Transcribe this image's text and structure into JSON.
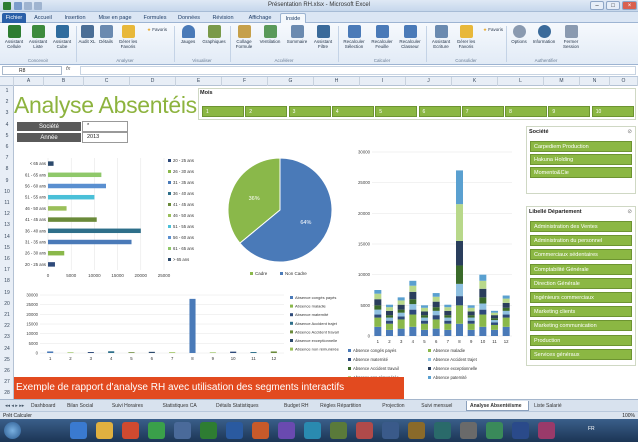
{
  "window": {
    "title": "Présentation RH.xlsx - Microsoft Excel"
  },
  "ribbon": {
    "tabs": [
      "Fichier",
      "Accueil",
      "Insertion",
      "Mise en page",
      "Formules",
      "Données",
      "Révision",
      "Affichage",
      "Inside"
    ],
    "active_tab": "Inside",
    "favoris_label": "Favoris",
    "buttons": [
      "Assistant Cellule",
      "Assistant Liste",
      "Assistant Cube",
      "Audit XL",
      "Détails",
      "Gérer les Favoris",
      "Jauges",
      "Graphiques",
      "Collage Formule",
      "Ventilation",
      "Sommaire",
      "Assistant Filtre",
      "Recalculer Sélection",
      "Recalculer Feuille",
      "Recalculer Classeur",
      "Assistant Ecriture",
      "Gérer les Favoris",
      "Options",
      "Information",
      "Fermer Session"
    ],
    "groups": [
      "Concevoir",
      "Analyser",
      "Visualiser",
      "Accélérer",
      "Calculer",
      "Consolider",
      "Authentifier"
    ]
  },
  "formula_bar": {
    "name_box": "R8",
    "fx": "fx"
  },
  "columns": [
    "A",
    "B",
    "C",
    "D",
    "E",
    "F",
    "G",
    "H",
    "I",
    "J",
    "K",
    "L",
    "M",
    "N",
    "O"
  ],
  "rows": [
    "1",
    "2",
    "3",
    "4",
    "5",
    "6",
    "7",
    "8",
    "9",
    "10",
    "11",
    "12",
    "13",
    "14",
    "15",
    "16",
    "17",
    "18",
    "19",
    "20",
    "21",
    "22",
    "23",
    "24",
    "25",
    "26",
    "27",
    "28"
  ],
  "dashboard": {
    "title": "Analyse Absentéisme",
    "filters": [
      {
        "label": "Société",
        "value": "*"
      },
      {
        "label": "Année",
        "value": "2013"
      }
    ],
    "mois_label": "Mois",
    "mois": [
      "1",
      "2",
      "3",
      "4",
      "5",
      "6",
      "7",
      "8",
      "9",
      "10"
    ],
    "societe_slicer": {
      "title": "Société",
      "items": [
        "Carpediem Production",
        "Hakuna Holding",
        "Momento&Cie"
      ]
    },
    "departement_slicer": {
      "title": "Libellé Département",
      "items": [
        "Administration des Ventes",
        "Administration du personnel",
        "Commerciaux sédentaires",
        "Comptabilité Générale",
        "Direction Générale",
        "Ingénieurs commerciaux",
        "Marketing clients",
        "Marketing communication",
        "Production",
        "Services généraux"
      ]
    },
    "banner": "Exemple de rapport d'analyse RH avec utilisation des segments interactifs"
  },
  "chart_data": [
    {
      "type": "bar",
      "orientation": "horizontal",
      "categories": [
        "< 65 ans",
        "61 - 65 ans",
        "56 - 60 ans",
        "51 - 55 ans",
        "46 - 50 ans",
        "41 - 45 ans",
        "36 - 40 ans",
        "31 - 35 ans",
        "26 - 30 ans",
        "20 - 25 ans"
      ],
      "values": [
        1200,
        11500,
        12500,
        10000,
        4000,
        10500,
        20000,
        18000,
        3500,
        1500
      ],
      "xlim": [
        0,
        25000
      ],
      "xticks": [
        "0",
        "5000",
        "10000",
        "15000",
        "20000",
        "25000"
      ],
      "legend": [
        "20 - 25 ans",
        "26 - 30 ans",
        "31 - 35 ans",
        "36 - 40 ans",
        "41 - 45 ans",
        "46 - 50 ans",
        "51 - 55 ans",
        "56 - 60 ans",
        "61 - 65 ans",
        "> 65 ans"
      ],
      "colors": [
        "#2e4a7a",
        "#8ab84a",
        "#4a7ab8",
        "#2e6f8a",
        "#6a8a3a",
        "#9abf5a",
        "#4ac0d8",
        "#5a8fd0",
        "#8fc86a",
        "#2c4a6c"
      ]
    },
    {
      "type": "pie",
      "categories": [
        "Cadre",
        "Non Cadre"
      ],
      "values": [
        36,
        64
      ],
      "labels": [
        "36%",
        "64%"
      ],
      "colors": [
        "#8ab84a",
        "#4a7ab8"
      ]
    },
    {
      "type": "bar",
      "stacked": true,
      "categories": [
        "1",
        "2",
        "3",
        "4",
        "5",
        "6",
        "7",
        "8",
        "9",
        "10",
        "11",
        "12"
      ],
      "ylim": [
        0,
        30000
      ],
      "yticks": [
        "0",
        "5000",
        "10000",
        "15000",
        "20000",
        "25000",
        "30000"
      ],
      "series": [
        {
          "name": "Absence congés payés",
          "values": [
            1500,
            1000,
            1200,
            1500,
            1000,
            1200,
            1000,
            2000,
            1000,
            1500,
            1000,
            1500
          ]
        },
        {
          "name": "Absence maladie",
          "values": [
            1500,
            1000,
            1500,
            2000,
            1000,
            1500,
            1000,
            3000,
            1000,
            2000,
            800,
            1500
          ]
        },
        {
          "name": "Absence maternité",
          "values": [
            500,
            500,
            500,
            800,
            500,
            700,
            500,
            1500,
            500,
            800,
            400,
            500
          ]
        },
        {
          "name": "Absence Accident trajet",
          "values": [
            800,
            500,
            600,
            900,
            500,
            700,
            500,
            2000,
            500,
            1000,
            400,
            600
          ]
        },
        {
          "name": "Absence Accident travail",
          "values": [
            700,
            400,
            500,
            800,
            400,
            600,
            400,
            3000,
            400,
            1000,
            300,
            500
          ]
        },
        {
          "name": "Absence exceptionnelle",
          "values": [
            1000,
            700,
            800,
            1200,
            600,
            900,
            700,
            4000,
            600,
            1400,
            500,
            800
          ]
        },
        {
          "name": "Absence non rémunérée",
          "values": [
            900,
            600,
            700,
            1000,
            600,
            800,
            600,
            6000,
            600,
            1300,
            400,
            700
          ]
        },
        {
          "name": "Absence paternité",
          "values": [
            600,
            400,
            500,
            800,
            400,
            600,
            400,
            5500,
            400,
            1000,
            300,
            500
          ]
        }
      ],
      "colors": [
        "#4a7ab8",
        "#8ab84a",
        "#2e4a7a",
        "#8fc0e0",
        "#3a6a2a",
        "#2a3e5c",
        "#b8d88a",
        "#5aa0d0"
      ]
    },
    {
      "type": "bar",
      "categories": [
        "1",
        "2",
        "3",
        "4",
        "5",
        "6",
        "7",
        "8",
        "9",
        "10",
        "11",
        "12"
      ],
      "values": [
        800,
        300,
        500,
        900,
        400,
        600,
        400,
        28000,
        300,
        700,
        500,
        800
      ],
      "ylim": [
        0,
        30000
      ],
      "yticks": [
        "0",
        "5000",
        "10000",
        "15000",
        "20000",
        "25000",
        "30000"
      ],
      "legend": [
        "Absence congés payés",
        "Absence maladie",
        "Absence maternité",
        "Absence Accident trajet",
        "Absence Accident travail",
        "Absence exceptionnelle",
        "Absence non rémunérée"
      ],
      "colors": [
        "#4a7ab8",
        "#8ab84a",
        "#2e4a7a",
        "#2e6f8a",
        "#6a8a3a",
        "#2c4a6c",
        "#9abf5a"
      ]
    }
  ],
  "sheet_tabs": [
    "Dashboard",
    "Bilan Social",
    "Suivi Horaires",
    "Statistiques CA",
    "Détails Statistiques",
    "Budget RH",
    "Règles Répartition",
    "Projection",
    "Suivi mensuel",
    "Analyse Absentéisme",
    "Liste Salarié"
  ],
  "active_sheet": "Analyse Absentéisme",
  "status": {
    "left": "Prêt   Calculer",
    "zoom": "100%"
  },
  "taskbar": {
    "tray": "FR"
  }
}
